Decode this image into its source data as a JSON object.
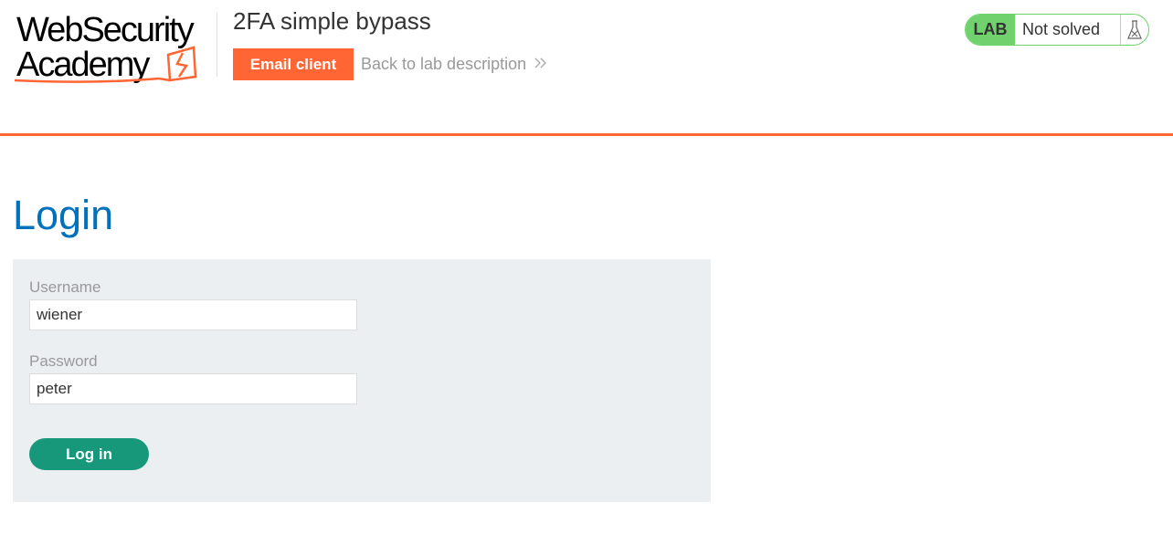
{
  "logo": {
    "line1": "WebSecurity",
    "line2": "Academy"
  },
  "header": {
    "lab_title": "2FA simple bypass",
    "email_client_label": "Email client",
    "back_link_label": "Back to lab description"
  },
  "lab_status": {
    "badge": "LAB",
    "state": "Not solved"
  },
  "login": {
    "title": "Login",
    "username_label": "Username",
    "username_value": "wiener",
    "password_label": "Password",
    "password_value": "peter",
    "submit_label": "Log in"
  },
  "colors": {
    "accent": "#ff6633",
    "title_blue": "#0071bc",
    "lab_green": "#70d16d",
    "button_green": "#17987a",
    "panel_bg": "#ebeff2"
  },
  "icons": {
    "logo_mark": "academy-bolt-icon",
    "back_chevron": "double-chevron-right-icon",
    "lab_flask": "flask-icon"
  }
}
